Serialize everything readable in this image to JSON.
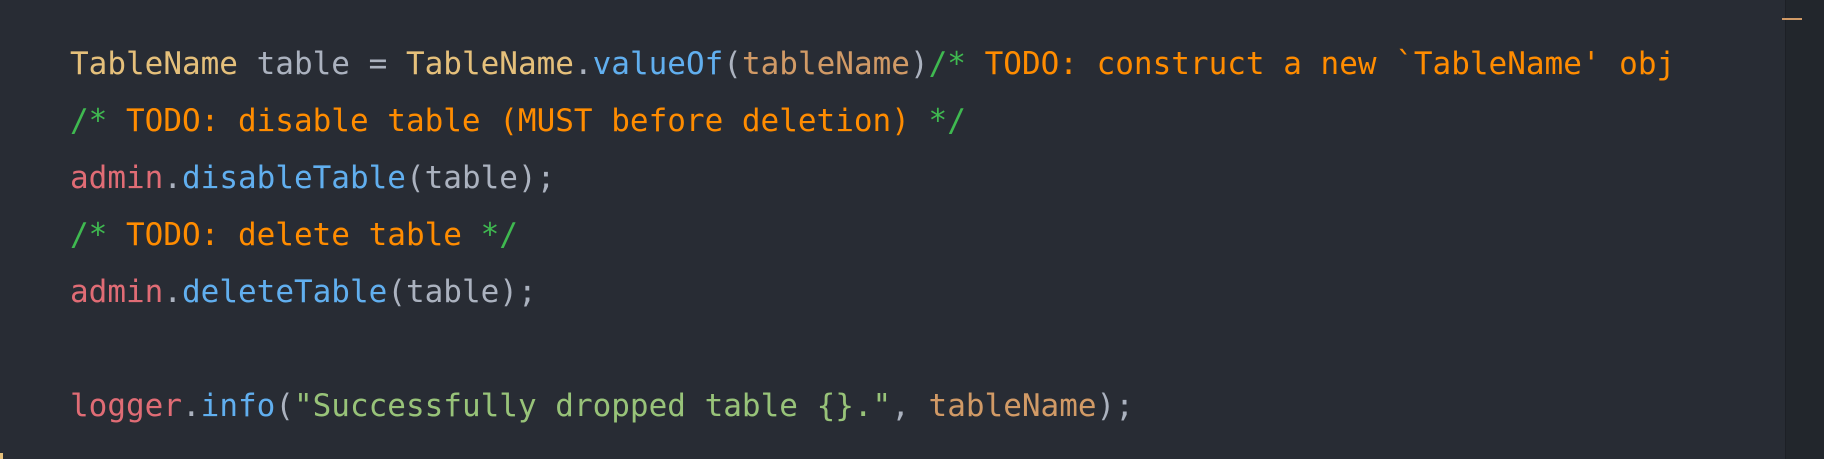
{
  "editor": {
    "lines": [
      {
        "tokens": [
          {
            "text": "TableName"
          },
          {
            "text": " table "
          },
          {
            "text": "="
          },
          {
            "text": " "
          },
          {
            "text": "TableName"
          },
          {
            "text": "."
          },
          {
            "text": "valueOf"
          },
          {
            "text": "("
          },
          {
            "text": "tableName"
          },
          {
            "text": ")"
          },
          {
            "text": "/*"
          },
          {
            "text": " TODO: construct a new `TableName' obj"
          }
        ]
      },
      {
        "tokens": [
          {
            "text": "/*"
          },
          {
            "text": " TODO: disable table (MUST before deletion) "
          },
          {
            "text": "*/"
          }
        ]
      },
      {
        "tokens": [
          {
            "text": "admin"
          },
          {
            "text": "."
          },
          {
            "text": "disableTable"
          },
          {
            "text": "(table);"
          }
        ]
      },
      {
        "tokens": [
          {
            "text": "/*"
          },
          {
            "text": " TODO: delete table "
          },
          {
            "text": "*/"
          }
        ]
      },
      {
        "tokens": [
          {
            "text": "admin"
          },
          {
            "text": "."
          },
          {
            "text": "deleteTable"
          },
          {
            "text": "(table);"
          }
        ]
      },
      {
        "tokens": []
      },
      {
        "tokens": [
          {
            "text": "logger"
          },
          {
            "text": "."
          },
          {
            "text": "info"
          },
          {
            "text": "("
          },
          {
            "text": "\"Successfully dropped table {}.\""
          },
          {
            "text": ", "
          },
          {
            "text": "tableName"
          },
          {
            "text": ");"
          }
        ]
      }
    ]
  },
  "theme": {
    "background": "#282c34",
    "type": "#e5c07b",
    "method": "#61afef",
    "object": "#e06c75",
    "param": "#d19a66",
    "comment_delimiter": "#3fb950",
    "todo": "#ff8c00",
    "string": "#98c379",
    "default": "#abb2bf"
  }
}
